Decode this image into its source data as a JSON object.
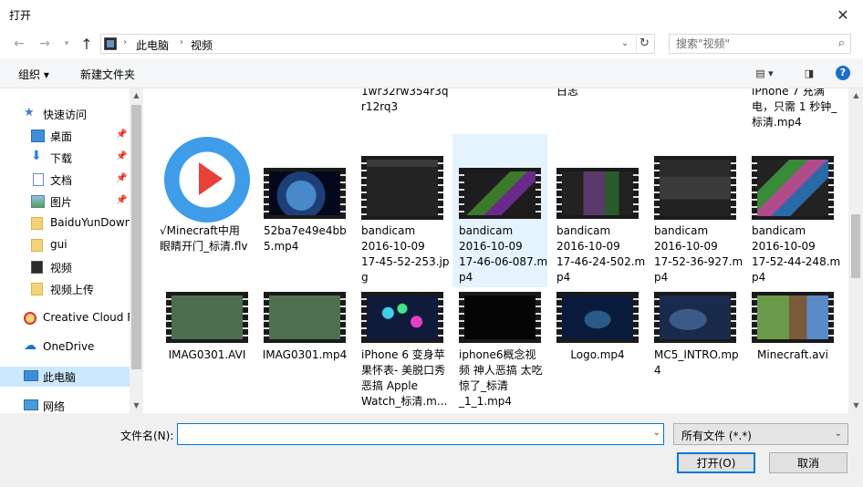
{
  "window": {
    "title": "打开"
  },
  "address": {
    "crumbs": [
      "此电脑",
      "视频"
    ]
  },
  "search": {
    "placeholder": "搜索\"视频\""
  },
  "toolbar": {
    "organize": "组织 ▾",
    "new_folder": "新建文件夹"
  },
  "sidebar": {
    "items": [
      {
        "label": "快速访问",
        "icon": "star-icon"
      },
      {
        "label": "桌面",
        "icon": "desktop-icon",
        "pinned": true
      },
      {
        "label": "下载",
        "icon": "download-icon",
        "pinned": true
      },
      {
        "label": "文档",
        "icon": "document-icon",
        "pinned": true
      },
      {
        "label": "图片",
        "icon": "picture-icon",
        "pinned": true
      },
      {
        "label": "BaiduYunDown",
        "icon": "folder-icon"
      },
      {
        "label": "gui",
        "icon": "folder-icon"
      },
      {
        "label": "视频",
        "icon": "video-folder-icon"
      },
      {
        "label": "视频上传",
        "icon": "folder-icon"
      },
      {
        "label": "Creative Cloud F",
        "icon": "creative-cloud-icon"
      },
      {
        "label": "OneDrive",
        "icon": "onedrive-icon"
      },
      {
        "label": "此电脑",
        "icon": "computer-icon",
        "selected": true
      },
      {
        "label": "网络",
        "icon": "network-icon"
      }
    ]
  },
  "files": {
    "row0": [
      {
        "label": "1wr32rw354r3q\nr12rq3"
      },
      {
        "label": ""
      },
      {
        "label": "日志"
      },
      {
        "label": ""
      },
      {
        "label": ""
      },
      {
        "label": ""
      },
      {
        "label": "iPhone 7 充满\n电，只需 1 秒钟_\n标清.mp4"
      }
    ],
    "row1": [
      {
        "label": "√Minecraft中用\n眼睛开门_标清.flv"
      },
      {
        "label": "52ba7e49e4bb\n5.mp4"
      },
      {
        "label": "bandicam\n2016-10-09\n17-45-52-253.jp\ng"
      },
      {
        "label": "bandicam\n2016-10-09\n17-46-06-087.m\np4"
      },
      {
        "label": "bandicam\n2016-10-09\n17-46-24-502.m\np4"
      },
      {
        "label": "bandicam\n2016-10-09\n17-52-36-927.m\np4"
      },
      {
        "label": "bandicam\n2016-10-09\n17-52-44-248.m\np4"
      }
    ],
    "row2": [
      {
        "label": "IMAG0301.AVI"
      },
      {
        "label": "IMAG0301.mp4"
      },
      {
        "label": "iPhone 6 变身苹\n果怀表- 美脱口秀\n恶搞 Apple\nWatch_标清.m..."
      },
      {
        "label": "iphone6概念视\n频 神人恶搞 太吃\n惊了_标清\n_1_1.mp4"
      },
      {
        "label": "Logo.mp4"
      },
      {
        "label": "MC5_INTRO.mp\n4"
      },
      {
        "label": "Minecraft.avi"
      }
    ]
  },
  "footer": {
    "filename_label": "文件名(N):",
    "filename_value": "",
    "filetype_value": "所有文件 (*.*)",
    "open_button": "打开(O)",
    "cancel_button": "取消"
  },
  "colors": {
    "selection": "#cce8ff",
    "accent": "#0078d7"
  }
}
